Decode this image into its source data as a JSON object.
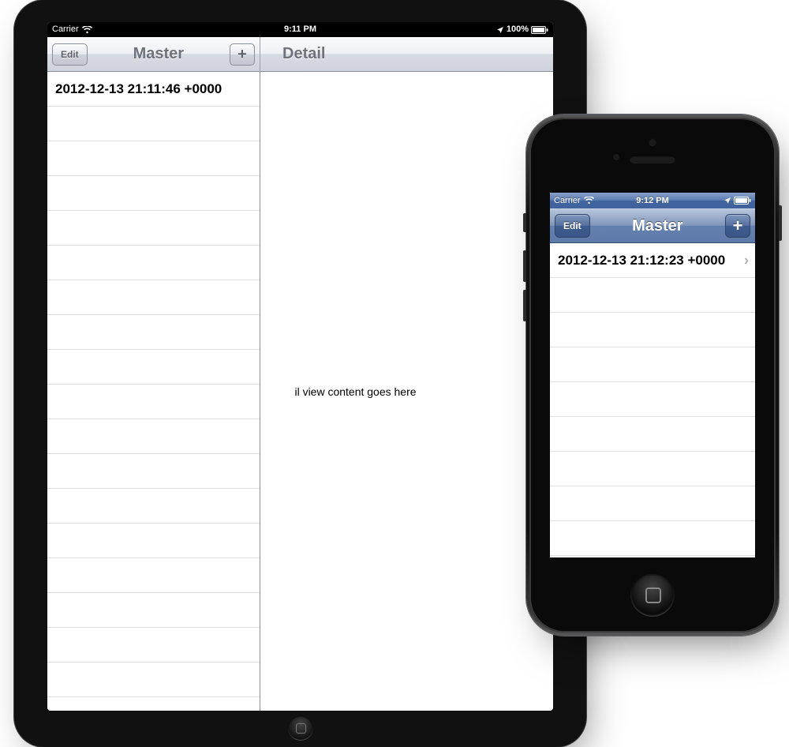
{
  "ipad": {
    "status": {
      "carrier": "Carrier",
      "time": "9:11 PM",
      "battery": "100%"
    },
    "master": {
      "title": "Master",
      "edit_label": "Edit",
      "add_label": "+",
      "rows": [
        "2012-12-13 21:11:46 +0000"
      ]
    },
    "detail": {
      "title": "Detail",
      "placeholder": "il view content goes here"
    }
  },
  "iphone": {
    "status": {
      "carrier": "Carrier",
      "time": "9:12 PM",
      "battery": ""
    },
    "master": {
      "title": "Master",
      "edit_label": "Edit",
      "add_label": "+",
      "rows": [
        "2012-12-13 21:12:23 +0000"
      ]
    }
  }
}
